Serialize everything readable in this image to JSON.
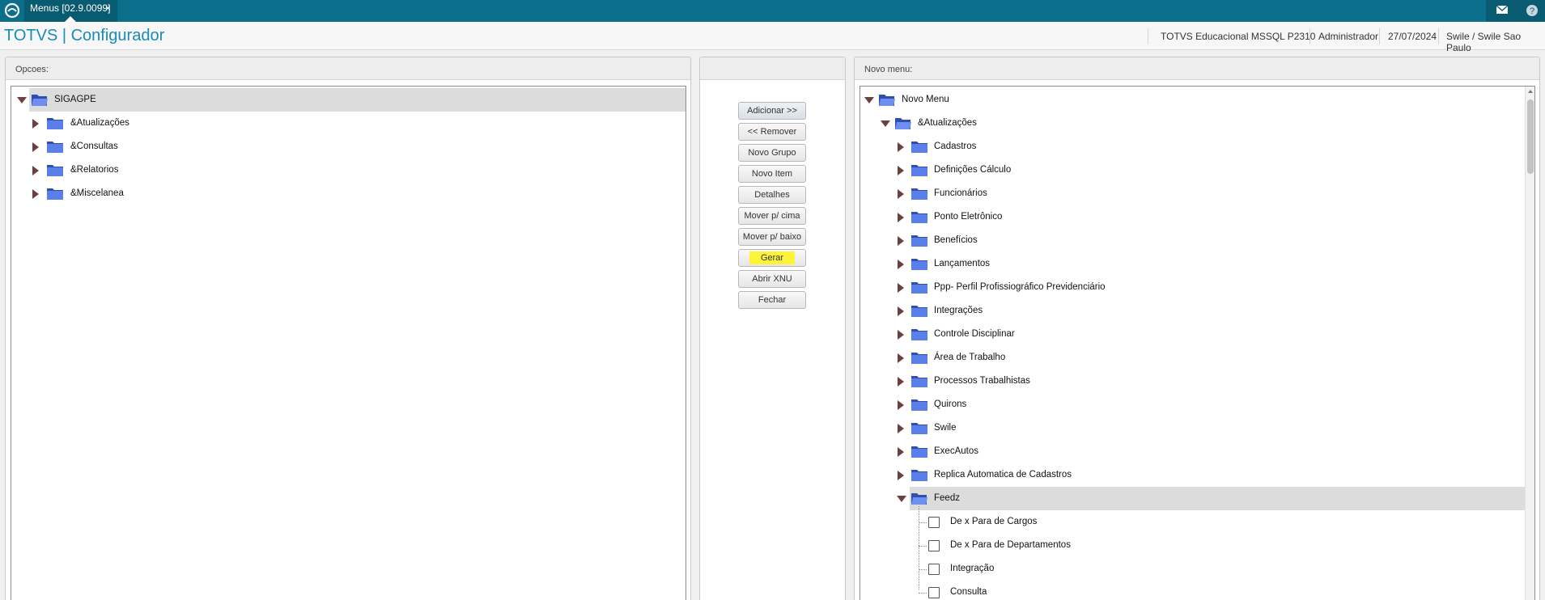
{
  "tab": {
    "label": "Menus [02.9.0099]",
    "close": "×"
  },
  "header": {
    "title": "TOTVS | Configurador",
    "environment": "TOTVS Educacional MSSQL P2310",
    "user": "Administrador",
    "date": "27/07/2024",
    "branch": "Swile / Swile Sao Paulo"
  },
  "left_panel": {
    "title": "Opcoes:",
    "root": "SIGAGPE",
    "items": [
      "&Atualizações",
      "&Consultas",
      "&Relatorios",
      "&Miscelanea"
    ]
  },
  "buttons": [
    {
      "label": "Adicionar >>"
    },
    {
      "label": "<< Remover"
    },
    {
      "label": "Novo Grupo"
    },
    {
      "label": "Novo Item"
    },
    {
      "label": "Detalhes"
    },
    {
      "label": "Mover p/ cima"
    },
    {
      "label": "Mover p/ baixo"
    },
    {
      "label": "Gerar"
    },
    {
      "label": "Abrir XNU"
    },
    {
      "label": "Fechar"
    }
  ],
  "right_panel": {
    "title": "Novo menu:",
    "root": "Novo Menu",
    "group": "&Atualizações",
    "items": [
      "Cadastros",
      "Definições Cálculo",
      "Funcionários",
      "Ponto Eletrônico",
      "Benefícios",
      "Lançamentos",
      "Ppp- Perfil Profissiográfico Previdenciário",
      "Integrações",
      "Controle Disciplinar",
      "Área de Trabalho",
      "Processos Trabalhistas",
      "Quirons",
      "Swile",
      "ExecAutos",
      "Replica Automatica de Cadastros"
    ],
    "expanded_item": "Feedz",
    "leaves": [
      "De x Para de Cargos",
      "De x Para de Departamentos",
      "Integração",
      "Consulta"
    ]
  },
  "colors": {
    "topbar": "#0b6e8a",
    "title": "#1a8bb4",
    "highlight": "#fdf43a",
    "folder": "#4a6fd6"
  }
}
